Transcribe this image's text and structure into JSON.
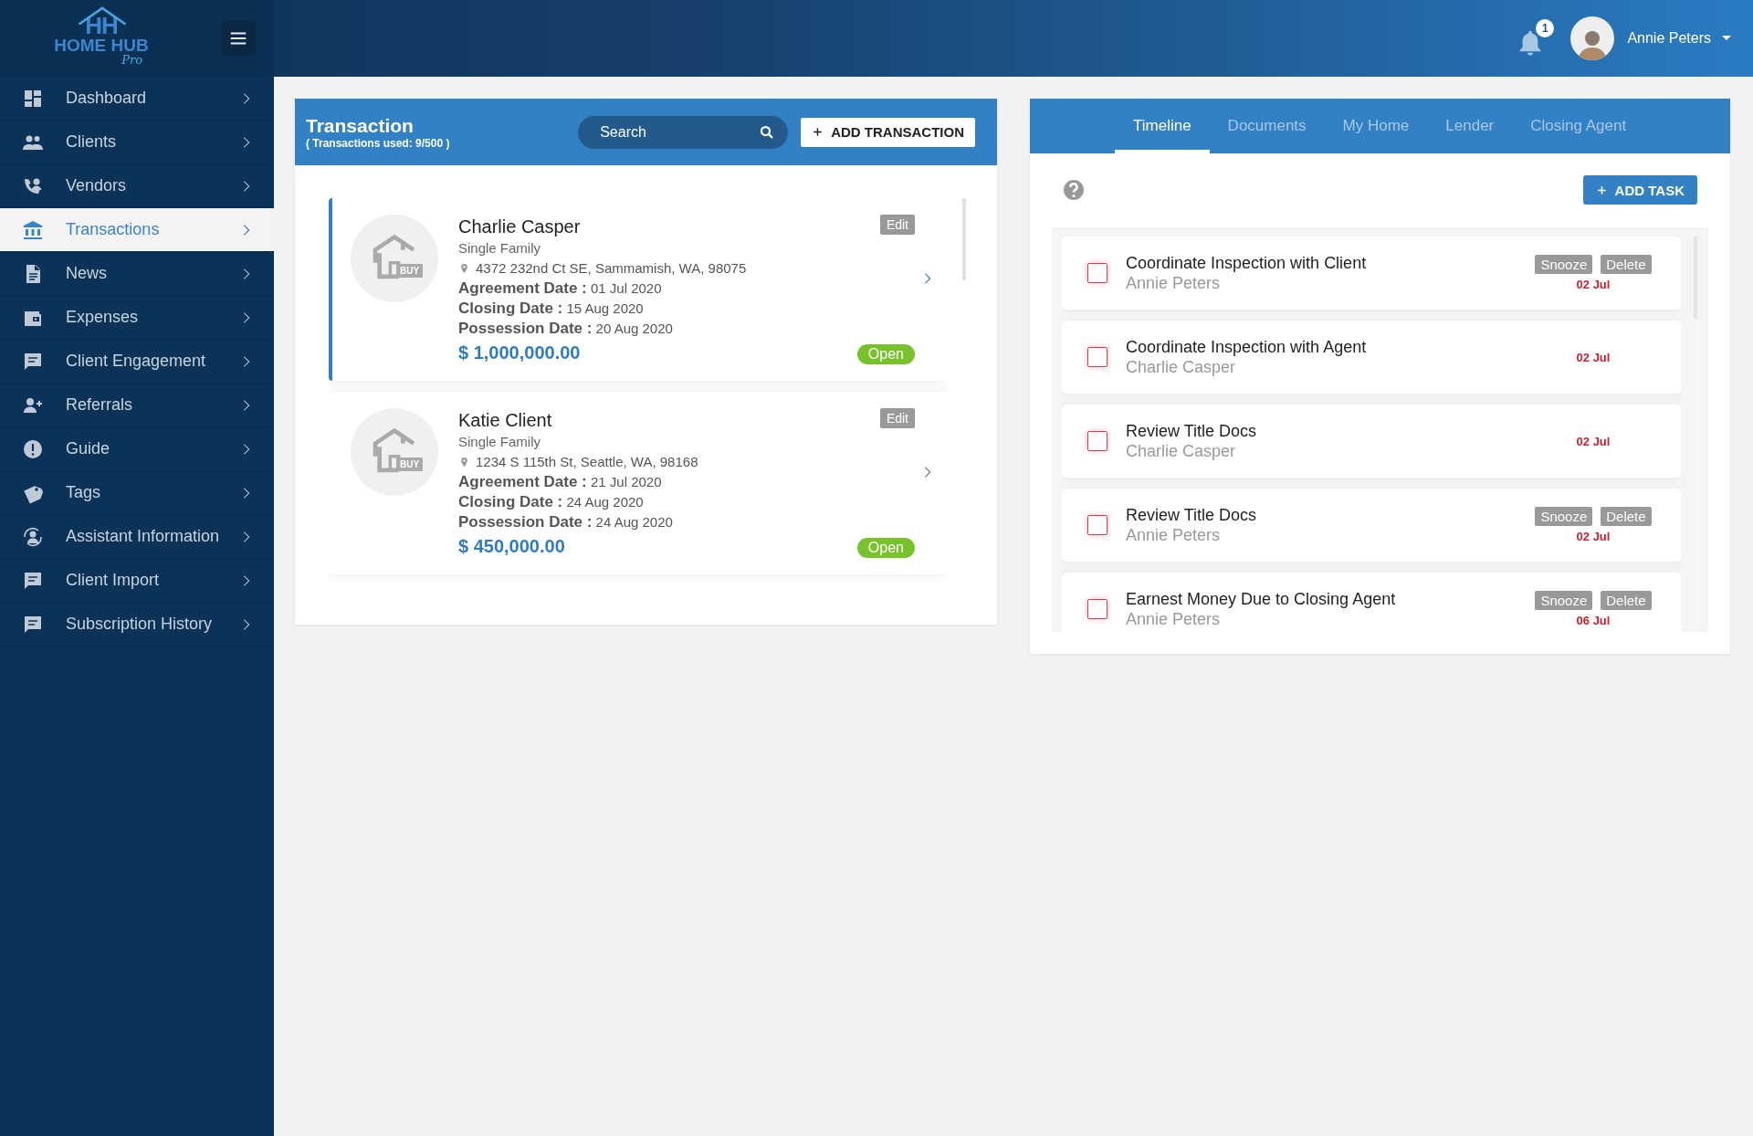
{
  "logo": {
    "initials": "HH",
    "name": "HOME HUB",
    "tagline": "Pro"
  },
  "header": {
    "notifications": "1",
    "user": "Annie Peters"
  },
  "sidebar": {
    "items": [
      {
        "label": "Dashboard",
        "selected": false
      },
      {
        "label": "Clients",
        "selected": false
      },
      {
        "label": "Vendors",
        "selected": false
      },
      {
        "label": "Transactions",
        "selected": true
      },
      {
        "label": "News",
        "selected": false
      },
      {
        "label": "Expenses",
        "selected": false
      },
      {
        "label": "Client Engagement",
        "selected": false
      },
      {
        "label": "Referrals",
        "selected": false
      },
      {
        "label": "Guide",
        "selected": false
      },
      {
        "label": "Tags",
        "selected": false
      },
      {
        "label": "Assistant Information",
        "selected": false
      },
      {
        "label": "Client Import",
        "selected": false
      },
      {
        "label": "Subscription History",
        "selected": false
      }
    ]
  },
  "transactions": {
    "title": "Transaction",
    "usage": "( Transactions used: 9/500 )",
    "search": {
      "placeholder": "Search"
    },
    "add_button": "ADD TRANSACTION",
    "cards": [
      {
        "name": "Charlie Casper",
        "type": "Single Family",
        "address": "4372 232nd Ct SE, Sammamish, WA, 98075",
        "tag": "BUY",
        "edit": "Edit",
        "dates": [
          {
            "label": "Agreement Date :",
            "value": "01 Jul 2020"
          },
          {
            "label": "Closing Date :",
            "value": "15 Aug 2020"
          },
          {
            "label": "Possession Date :",
            "value": "20 Aug 2020"
          }
        ],
        "price": "$ 1,000,000.00",
        "status": "Open",
        "selected": true
      },
      {
        "name": "Katie Client",
        "type": "Single Family",
        "address": "1234 S 115th St, Seattle, WA, 98168",
        "tag": "BUY",
        "edit": "Edit",
        "dates": [
          {
            "label": "Agreement Date :",
            "value": "21 Jul 2020"
          },
          {
            "label": "Closing Date :",
            "value": "24 Aug 2020"
          },
          {
            "label": "Possession Date :",
            "value": "24 Aug 2020"
          }
        ],
        "price": "$ 450,000.00",
        "status": "Open",
        "selected": false
      }
    ]
  },
  "timeline": {
    "tabs": [
      {
        "label": "Timeline",
        "selected": true
      },
      {
        "label": "Documents",
        "selected": false
      },
      {
        "label": "My Home",
        "selected": false
      },
      {
        "label": "Lender",
        "selected": false
      },
      {
        "label": "Closing Agent",
        "selected": false
      }
    ],
    "add_button": "ADD TASK",
    "tasks": [
      {
        "title": "Coordinate Inspection with Client",
        "person": "Annie Peters",
        "date": "02 Jul",
        "checked": false,
        "actions": [
          "Snooze",
          "Delete"
        ]
      },
      {
        "title": "Coordinate Inspection with Agent",
        "person": "Charlie Casper",
        "date": "02 Jul",
        "checked": false
      },
      {
        "title": "Review Title Docs",
        "person": "Charlie Casper",
        "date": "02 Jul",
        "checked": false
      },
      {
        "title": "Review Title Docs",
        "person": "Annie Peters",
        "date": "02 Jul",
        "checked": false,
        "actions": [
          "Snooze",
          "Delete"
        ]
      },
      {
        "title": "Earnest Money Due to Closing Agent",
        "person": "Annie Peters",
        "date": "06 Jul",
        "checked": false,
        "actions": [
          "Snooze",
          "Delete"
        ]
      }
    ]
  }
}
